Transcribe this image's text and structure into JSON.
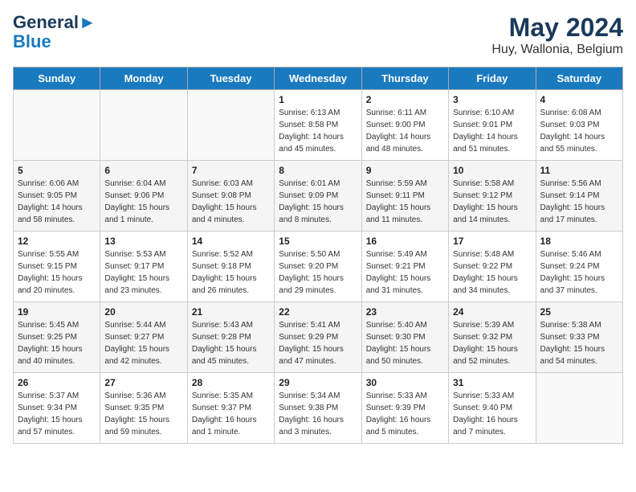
{
  "header": {
    "logo_line1": "General",
    "logo_line2": "Blue",
    "title": "May 2024",
    "subtitle": "Huy, Wallonia, Belgium"
  },
  "days_of_week": [
    "Sunday",
    "Monday",
    "Tuesday",
    "Wednesday",
    "Thursday",
    "Friday",
    "Saturday"
  ],
  "weeks": [
    [
      {
        "day": "",
        "sunrise": "",
        "sunset": "",
        "daylight": ""
      },
      {
        "day": "",
        "sunrise": "",
        "sunset": "",
        "daylight": ""
      },
      {
        "day": "",
        "sunrise": "",
        "sunset": "",
        "daylight": ""
      },
      {
        "day": "1",
        "sunrise": "6:13 AM",
        "sunset": "8:58 PM",
        "daylight": "14 hours and 45 minutes."
      },
      {
        "day": "2",
        "sunrise": "6:11 AM",
        "sunset": "9:00 PM",
        "daylight": "14 hours and 48 minutes."
      },
      {
        "day": "3",
        "sunrise": "6:10 AM",
        "sunset": "9:01 PM",
        "daylight": "14 hours and 51 minutes."
      },
      {
        "day": "4",
        "sunrise": "6:08 AM",
        "sunset": "9:03 PM",
        "daylight": "14 hours and 55 minutes."
      }
    ],
    [
      {
        "day": "5",
        "sunrise": "6:06 AM",
        "sunset": "9:05 PM",
        "daylight": "14 hours and 58 minutes."
      },
      {
        "day": "6",
        "sunrise": "6:04 AM",
        "sunset": "9:06 PM",
        "daylight": "15 hours and 1 minute."
      },
      {
        "day": "7",
        "sunrise": "6:03 AM",
        "sunset": "9:08 PM",
        "daylight": "15 hours and 4 minutes."
      },
      {
        "day": "8",
        "sunrise": "6:01 AM",
        "sunset": "9:09 PM",
        "daylight": "15 hours and 8 minutes."
      },
      {
        "day": "9",
        "sunrise": "5:59 AM",
        "sunset": "9:11 PM",
        "daylight": "15 hours and 11 minutes."
      },
      {
        "day": "10",
        "sunrise": "5:58 AM",
        "sunset": "9:12 PM",
        "daylight": "15 hours and 14 minutes."
      },
      {
        "day": "11",
        "sunrise": "5:56 AM",
        "sunset": "9:14 PM",
        "daylight": "15 hours and 17 minutes."
      }
    ],
    [
      {
        "day": "12",
        "sunrise": "5:55 AM",
        "sunset": "9:15 PM",
        "daylight": "15 hours and 20 minutes."
      },
      {
        "day": "13",
        "sunrise": "5:53 AM",
        "sunset": "9:17 PM",
        "daylight": "15 hours and 23 minutes."
      },
      {
        "day": "14",
        "sunrise": "5:52 AM",
        "sunset": "9:18 PM",
        "daylight": "15 hours and 26 minutes."
      },
      {
        "day": "15",
        "sunrise": "5:50 AM",
        "sunset": "9:20 PM",
        "daylight": "15 hours and 29 minutes."
      },
      {
        "day": "16",
        "sunrise": "5:49 AM",
        "sunset": "9:21 PM",
        "daylight": "15 hours and 31 minutes."
      },
      {
        "day": "17",
        "sunrise": "5:48 AM",
        "sunset": "9:22 PM",
        "daylight": "15 hours and 34 minutes."
      },
      {
        "day": "18",
        "sunrise": "5:46 AM",
        "sunset": "9:24 PM",
        "daylight": "15 hours and 37 minutes."
      }
    ],
    [
      {
        "day": "19",
        "sunrise": "5:45 AM",
        "sunset": "9:25 PM",
        "daylight": "15 hours and 40 minutes."
      },
      {
        "day": "20",
        "sunrise": "5:44 AM",
        "sunset": "9:27 PM",
        "daylight": "15 hours and 42 minutes."
      },
      {
        "day": "21",
        "sunrise": "5:43 AM",
        "sunset": "9:28 PM",
        "daylight": "15 hours and 45 minutes."
      },
      {
        "day": "22",
        "sunrise": "5:41 AM",
        "sunset": "9:29 PM",
        "daylight": "15 hours and 47 minutes."
      },
      {
        "day": "23",
        "sunrise": "5:40 AM",
        "sunset": "9:30 PM",
        "daylight": "15 hours and 50 minutes."
      },
      {
        "day": "24",
        "sunrise": "5:39 AM",
        "sunset": "9:32 PM",
        "daylight": "15 hours and 52 minutes."
      },
      {
        "day": "25",
        "sunrise": "5:38 AM",
        "sunset": "9:33 PM",
        "daylight": "15 hours and 54 minutes."
      }
    ],
    [
      {
        "day": "26",
        "sunrise": "5:37 AM",
        "sunset": "9:34 PM",
        "daylight": "15 hours and 57 minutes."
      },
      {
        "day": "27",
        "sunrise": "5:36 AM",
        "sunset": "9:35 PM",
        "daylight": "15 hours and 59 minutes."
      },
      {
        "day": "28",
        "sunrise": "5:35 AM",
        "sunset": "9:37 PM",
        "daylight": "16 hours and 1 minute."
      },
      {
        "day": "29",
        "sunrise": "5:34 AM",
        "sunset": "9:38 PM",
        "daylight": "16 hours and 3 minutes."
      },
      {
        "day": "30",
        "sunrise": "5:33 AM",
        "sunset": "9:39 PM",
        "daylight": "16 hours and 5 minutes."
      },
      {
        "day": "31",
        "sunrise": "5:33 AM",
        "sunset": "9:40 PM",
        "daylight": "16 hours and 7 minutes."
      },
      {
        "day": "",
        "sunrise": "",
        "sunset": "",
        "daylight": ""
      }
    ]
  ]
}
